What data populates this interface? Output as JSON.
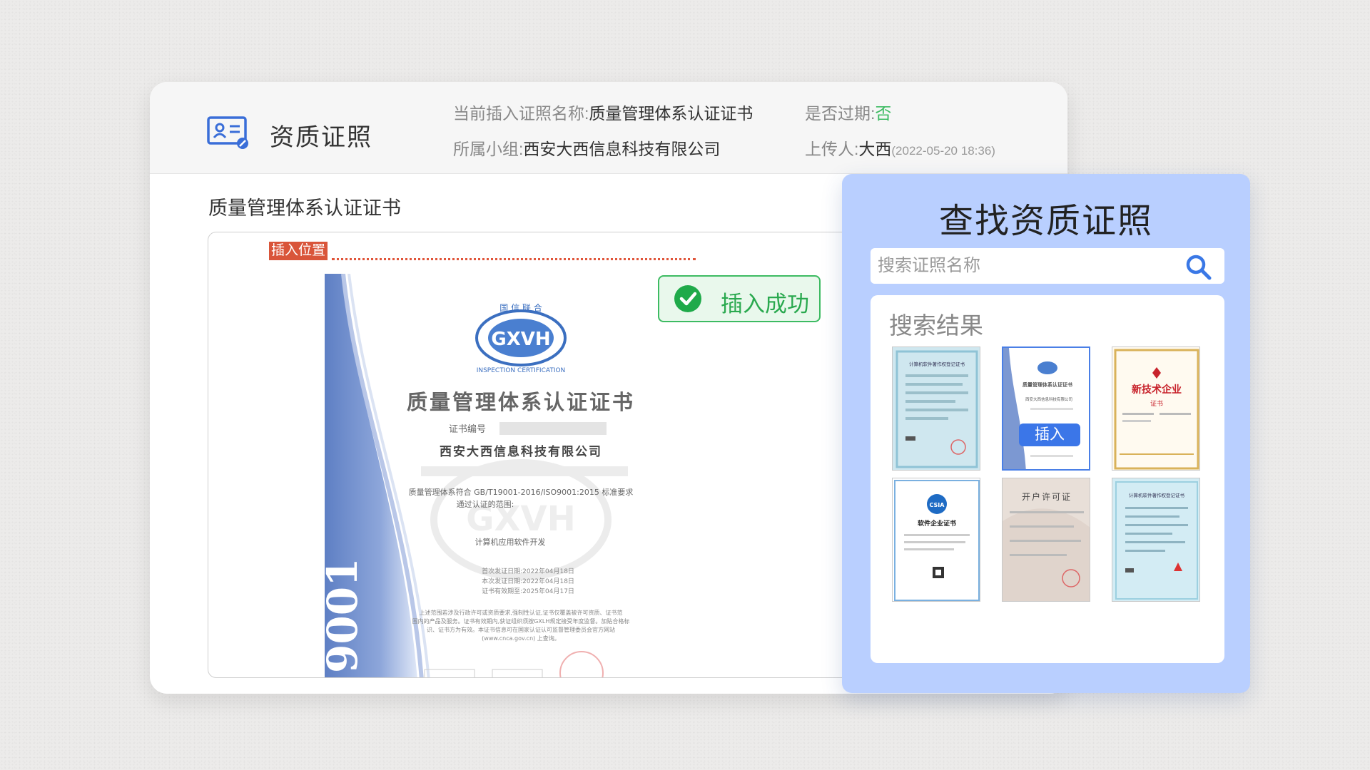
{
  "header": {
    "app_title": "资质证照",
    "current_label": "当前插入证照名称:",
    "current_value": "质量管理体系认证证书",
    "expired_label": "是否过期:",
    "expired_value": "否",
    "group_label": "所属小组:",
    "group_value": "西安大西信息科技有限公司",
    "uploader_label": "上传人:",
    "uploader_value": "大西",
    "upload_time": "(2022-05-20 18:36)"
  },
  "document": {
    "title": "质量管理体系认证证书",
    "insert_position_label": "插入位置",
    "success_message": "插入成功",
    "certificate": {
      "emblem_text": "GXVH",
      "arc_text": "国 信 联 合",
      "arc_text_bottom": "INSPECTION CERTIFICATION",
      "title": "质量管理体系认证证书",
      "number_label": "证书编号",
      "company": "西安大西信息科技有限公司",
      "standard_text": "质量管理体系符合 GB/T19001-2016/ISO9001:2015 标准要求",
      "scope_label": "通过认证的范围:",
      "scope_value": "计算机应用软件开发",
      "date_issue": "首次发证日期:2022年04月18日",
      "date_current": "本次发证日期:2022年04月18日",
      "date_valid": "证书有效期至:2025年04月17日",
      "footer_1": "上述范围若涉及行政许可或资质要求,强制性认证,证书仅覆盖被许可资质、证书范",
      "footer_2": "围内的产品及服务。证书有效期内,获证组织须按GXLH规定接受年度监督。加贴合格标",
      "footer_3": "识、证书方为有效。本证书信息可在国家认证认可监督管理委员会官方网站",
      "footer_4": "(www.cnca.gov.cn) 上查询。",
      "side_number": "9001"
    }
  },
  "search_panel": {
    "title": "查找资质证照",
    "search_placeholder": "搜索证照名称",
    "results_label": "搜索结果",
    "insert_button": "插入",
    "thumbnails": [
      {
        "title": "计算机软件著作权登记证书"
      },
      {
        "title": "质量管理体系认证证书",
        "company": "西安大西信息科技有限公司"
      },
      {
        "title": "新技术企业",
        "subtitle": "证书"
      },
      {
        "title": "软件企业证书",
        "badge": "CSIA"
      },
      {
        "title": "开户许可证"
      },
      {
        "title": "计算机软件著作权登记证书"
      }
    ]
  },
  "colors": {
    "accent_blue": "#3b76e8",
    "success_green": "#3dbb62",
    "insert_red": "#d9553a",
    "panel_bg": "#b9cfff"
  }
}
